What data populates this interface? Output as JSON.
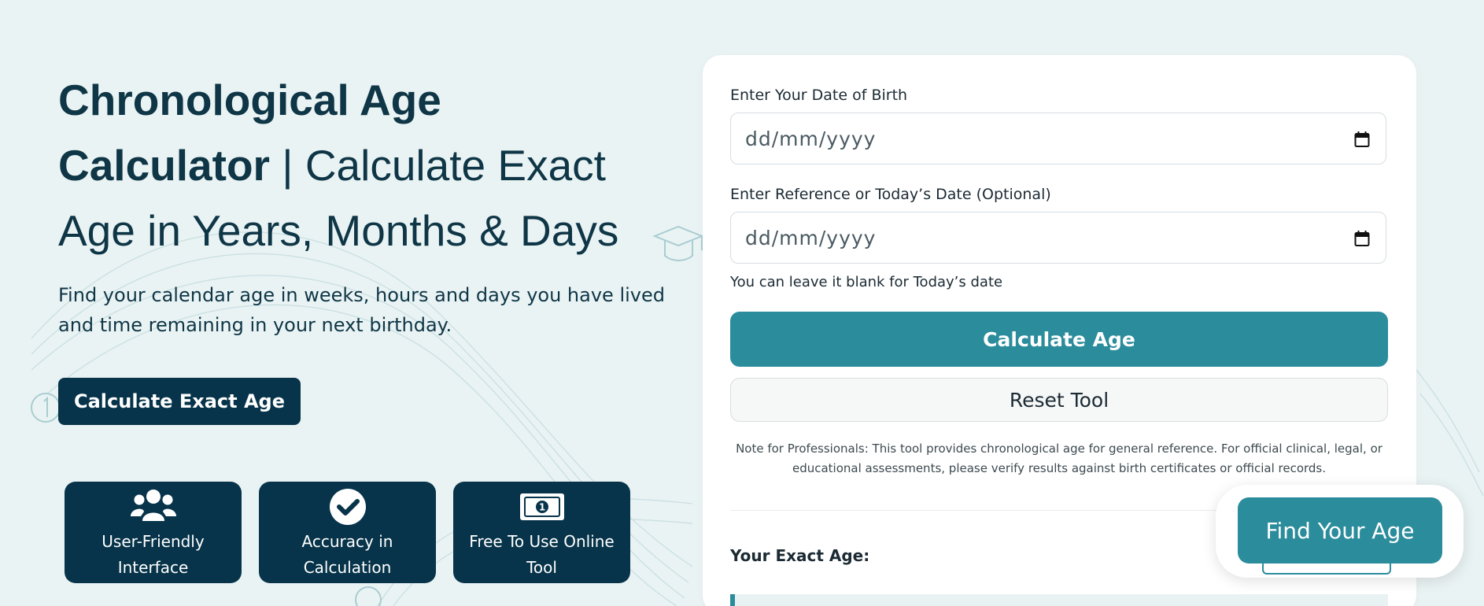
{
  "hero": {
    "title_bold_1": "Chronological Age",
    "title_bold_2": "Calculator",
    "title_rest_1": " | Calculate Exact",
    "title_rest_2": "Age in Years, Months & Days",
    "subtitle": "Find your calendar age in weeks, hours and days you have lived and time remaining in your next birthday.",
    "cta_label": "Calculate Exact Age"
  },
  "features": [
    {
      "label": "User-Friendly Interface",
      "icon": "users-icon"
    },
    {
      "label": "Accuracy in Calculation",
      "icon": "check-circle-icon"
    },
    {
      "label": "Free To Use Online Tool",
      "icon": "money-bill-icon"
    }
  ],
  "form": {
    "dob_label": "Enter Your Date of Birth",
    "dob_placeholder": "dd/mm/yyyy",
    "ref_label": "Enter Reference or Today’s Date (Optional)",
    "ref_placeholder": "dd/mm/yyyy",
    "hint": "You can leave it blank for Today’s date",
    "calculate_label": "Calculate Age",
    "reset_label": "Reset Tool",
    "note": "Note for Professionals: This tool provides chronological age for general reference. For official clinical, legal, or educational assessments, please verify results against birth certificates or official records.",
    "result_label": "Your Exact Age:"
  },
  "floating": {
    "label": "Find Your Age"
  },
  "colors": {
    "background": "#eaf3f4",
    "dark_navy": "#07344a",
    "teal": "#2b8c9c"
  }
}
